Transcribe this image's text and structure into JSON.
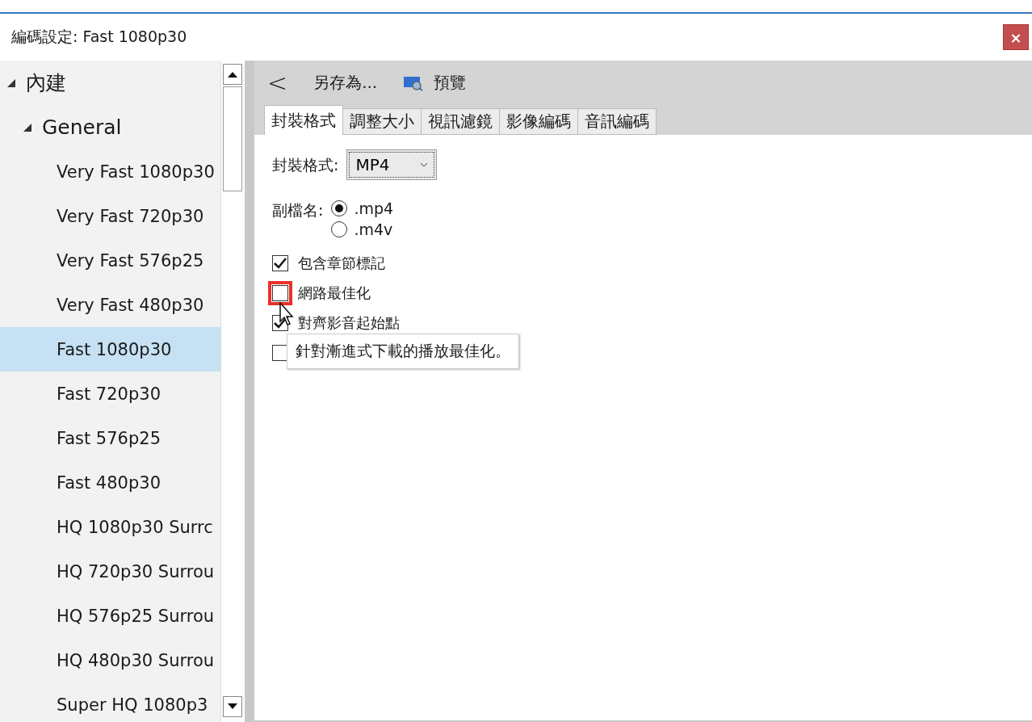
{
  "window": {
    "title": "編碼設定: Fast 1080p30",
    "close": "×"
  },
  "tree": [
    {
      "label": "內建",
      "expanded": true,
      "children": [
        {
          "label": "General",
          "expanded": true,
          "children": [
            {
              "label": "Very Fast 1080p30",
              "selected": false
            },
            {
              "label": "Very Fast 720p30",
              "selected": false
            },
            {
              "label": "Very Fast 576p25",
              "selected": false
            },
            {
              "label": "Very Fast 480p30",
              "selected": false
            },
            {
              "label": "Fast 1080p30",
              "selected": true
            },
            {
              "label": "Fast 720p30",
              "selected": false
            },
            {
              "label": "Fast 576p25",
              "selected": false
            },
            {
              "label": "Fast 480p30",
              "selected": false
            },
            {
              "label": "HQ 1080p30 Surrc",
              "selected": false
            },
            {
              "label": "HQ 720p30 Surrou",
              "selected": false
            },
            {
              "label": "HQ 576p25 Surrou",
              "selected": false
            },
            {
              "label": "HQ 480p30 Surrou",
              "selected": false
            },
            {
              "label": "Super HQ 1080p3",
              "selected": false
            }
          ]
        }
      ]
    }
  ],
  "toolbar": {
    "back": "<",
    "save_as": "另存為...",
    "preview": "預覽"
  },
  "tabs": [
    {
      "label": "封裝格式",
      "selected": true
    },
    {
      "label": "調整大小",
      "selected": false
    },
    {
      "label": "視訊濾鏡",
      "selected": false
    },
    {
      "label": "影像編碼",
      "selected": false
    },
    {
      "label": "音訊編碼",
      "selected": false
    }
  ],
  "container": {
    "label": "封裝格式:",
    "value": "MP4"
  },
  "extension": {
    "label": "副檔名:",
    "options": [
      {
        "label": ".mp4",
        "selected": true
      },
      {
        "label": ".m4v",
        "selected": false
      }
    ]
  },
  "checkboxes": [
    {
      "label": "包含章節標記",
      "checked": true,
      "highlighted": false
    },
    {
      "label": "網路最佳化",
      "checked": false,
      "highlighted": true
    },
    {
      "label": "對齊影音起始點",
      "checked": true,
      "highlighted": false
    },
    {
      "checked": false,
      "highlighted": false
    }
  ],
  "tooltip": "針對漸進式下載的播放最佳化。"
}
